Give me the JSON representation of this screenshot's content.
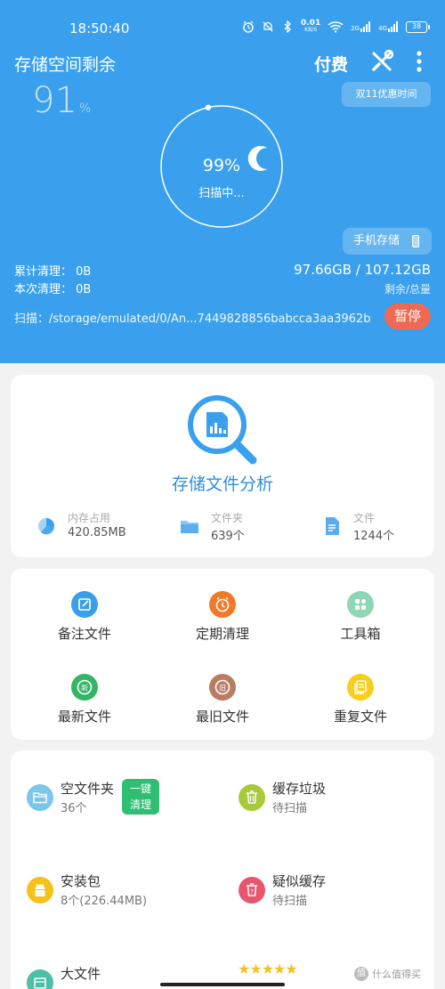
{
  "status_bar": {
    "time": "18:50:40",
    "net_speed_top": "0.01",
    "net_speed_unit": "KB/S",
    "signal_1": "2G",
    "signal_2": "4G",
    "battery": "38"
  },
  "header": {
    "title": "存储空间剩余",
    "pay_label": "付费",
    "tools_icon": "tools-icon",
    "more_icon": "more-vertical-icon"
  },
  "remaining_percent": {
    "value": "91",
    "unit": "%"
  },
  "promo_label": "双11优惠时间",
  "scan": {
    "progress_text": "99%",
    "progress_fraction": 0.99,
    "status_text": "扫描中...",
    "path_label": "扫描：",
    "path": "/storage/emulated/0/An...7449828856babcca3aa3962b",
    "pause_label": "暂停"
  },
  "storage_button_label": "手机存储",
  "stats": {
    "total_cleaned": "累计清理：  0B",
    "this_cleaned": "本次清理：  0B",
    "capacity": "97.66GB / 107.12GB",
    "capacity_label": "剩余/总量"
  },
  "analysis": {
    "title": "存储文件分析",
    "items": [
      {
        "icon": "pie-chart-icon",
        "label": "内存占用",
        "value": "420.85MB"
      },
      {
        "icon": "folder-icon",
        "label": "文件夹",
        "value": "639个"
      },
      {
        "icon": "file-icon",
        "label": "文件",
        "value": "1244个"
      }
    ]
  },
  "tools": [
    {
      "icon": "note-edit-icon",
      "label": "备注文件",
      "color": "#3a9ee8"
    },
    {
      "icon": "alarm-clock-icon",
      "label": "定期清理",
      "color": "#f07a2a"
    },
    {
      "icon": "toolbox-icon",
      "label": "工具箱",
      "color": "#8fd6b4"
    },
    {
      "icon": "new-file-icon",
      "label": "最新文件",
      "color": "#34b565"
    },
    {
      "icon": "old-file-icon",
      "label": "最旧文件",
      "color": "#b97d63"
    },
    {
      "icon": "duplicate-file-icon",
      "label": "重复文件",
      "color": "#f5cf1c"
    }
  ],
  "clean_items": [
    {
      "icon": "empty-folder-icon",
      "name": "空文件夹",
      "sub": "36个",
      "color": "#7cc6ea"
    },
    {
      "icon": "trash-icon",
      "name": "缓存垃圾",
      "sub": "待扫描",
      "color": "#a7c93a"
    },
    {
      "icon": "android-icon",
      "name": "安装包",
      "sub": "8个(226.44MB)",
      "color": "#f4c21b"
    },
    {
      "icon": "suspect-cache-icon",
      "name": "疑似缓存",
      "sub": "待扫描",
      "color": "#e8566c"
    },
    {
      "icon": "large-file-icon",
      "name": "大文件",
      "sub": "",
      "color": "#4dbfa6"
    }
  ],
  "one_key_clean": {
    "line1": "一键",
    "line2": "清理"
  },
  "rating_stars": 5,
  "watermark": {
    "mark": "值",
    "text": "什么值得买"
  }
}
